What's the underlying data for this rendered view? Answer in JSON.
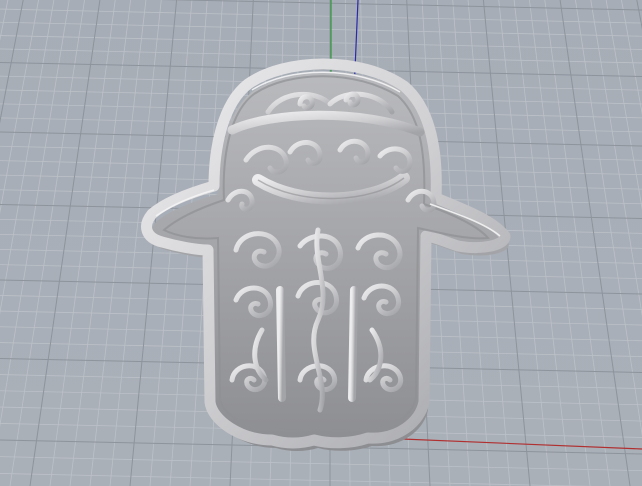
{
  "viewport": {
    "background": "#a9afb7",
    "grid_minor_color": "#bfc4cb",
    "grid_major_color": "#8f959d",
    "axis_x_color": "#b03030",
    "axis_y_color": "#2e9a3a",
    "axis_z_color": "#2a2aa8"
  },
  "model": {
    "icon": "hamsa-hand-icon",
    "material_color": "#cfcfd1",
    "shade_color": "#8f9093",
    "highlight_color": "#f2f2f3"
  }
}
